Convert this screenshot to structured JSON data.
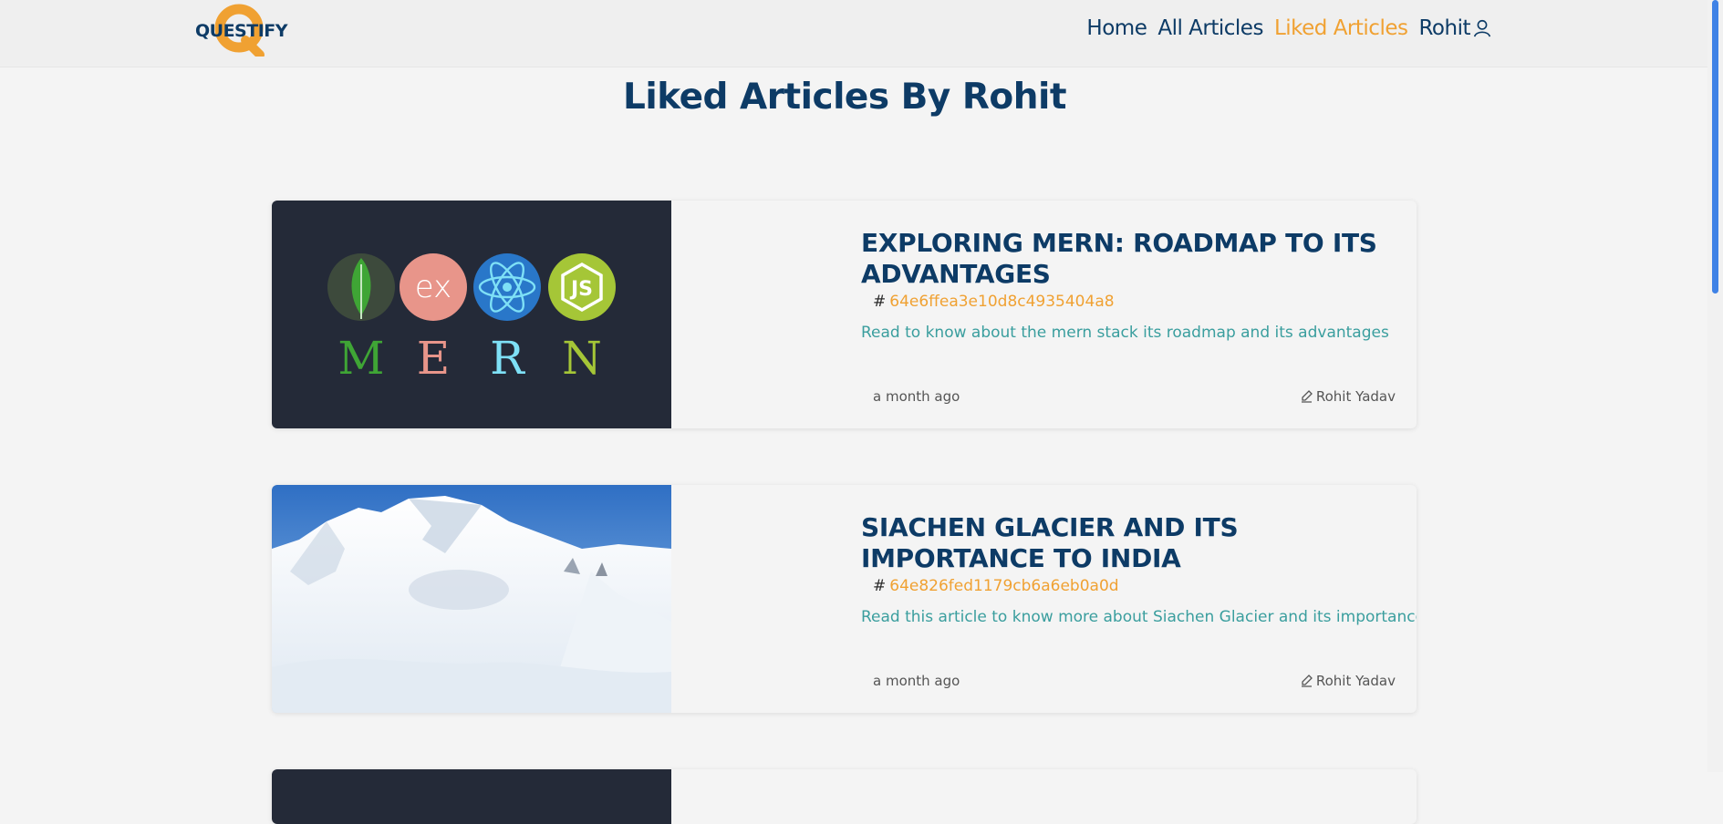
{
  "nav": {
    "logo_text": "QUESTIFY",
    "links": [
      {
        "label": "Home",
        "active": false
      },
      {
        "label": "All Articles",
        "active": false
      },
      {
        "label": "Liked Articles",
        "active": true
      },
      {
        "label": "Rohit",
        "active": false
      }
    ],
    "user_icon": "user-icon"
  },
  "page": {
    "title": "Liked Articles By Rohit"
  },
  "articles": [
    {
      "title": "EXPLORING MERN: ROADMAP TO ITS ADVANTAGES",
      "id": "64e6ffea3e10d8c4935404a8",
      "description": "Read to know about the mern stack its roadmap and its advantages",
      "time": "a month ago",
      "author": "Rohit Yadav",
      "image": "mern-logo-image",
      "image_letters": [
        "M",
        "E",
        "R",
        "N"
      ]
    },
    {
      "title": "SIACHEN GLACIER AND ITS IMPORTANCE TO INDIA",
      "id": "64e826fed1179cb6a6eb0a0d",
      "description": "Read this article to know more about Siachen Glacier and its importance",
      "time": "a month ago",
      "author": "Rohit Yadav",
      "image": "snowy-mountain-image"
    }
  ],
  "colors": {
    "primary": "#0d3b66",
    "accent": "#f0a132",
    "description": "#3a9e9e",
    "background": "#f4f4f4"
  }
}
